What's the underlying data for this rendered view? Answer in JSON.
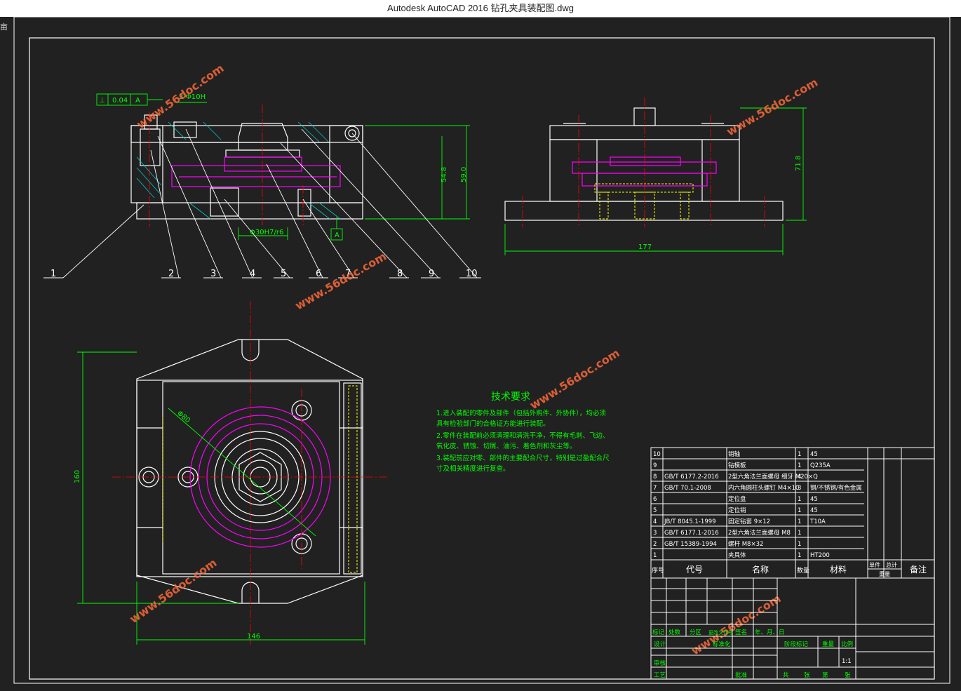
{
  "window": {
    "title": "Autodesk AutoCAD 2016    钻孔夹具装配图.dwg",
    "side_mark": "亩"
  },
  "colors": {
    "background": "#212121",
    "white_line": "#ffffff",
    "dim_green": "#00ff00",
    "magenta": "#ff00ff",
    "yellow": "#ffff00",
    "red_center": "#ff0000"
  },
  "front_view": {
    "tolerance_frame": [
      "⊥",
      "0.04",
      "A"
    ],
    "hole_note": "3-Φ10H",
    "dims": {
      "height_inner": "54.8",
      "height_outer": "59.0",
      "bore": "Φ30H7/r6"
    },
    "datum": "A",
    "balloons": [
      "1",
      "2",
      "3",
      "4",
      "5",
      "6",
      "7",
      "8",
      "9",
      "10"
    ]
  },
  "side_view": {
    "dims": {
      "height": "71.8",
      "width": "177"
    }
  },
  "top_view": {
    "dims": {
      "height": "160",
      "width": "146",
      "pcd": "Φ80"
    }
  },
  "tech_req": {
    "title": "技术要求",
    "lines": [
      "1.进入装配的零件及部件（包括外购件、外协件），均必须",
      "  具有检验部门的合格证方能进行装配。",
      "2.零件在装配前必须清理和清洗干净，不得有毛刺、飞边、",
      "  氧化皮、锈蚀、切屑、油污、着色剂和灰尘等。",
      "3.装配前应对零、部件的主要配合尺寸，特别是过盈配合尺",
      "  寸及相关精度进行复查。"
    ]
  },
  "watermark": "www.56doc.com",
  "bom": {
    "rows": [
      {
        "no": "10",
        "code": "",
        "name": "销轴",
        "qty": "1",
        "material": "45"
      },
      {
        "no": "9",
        "code": "",
        "name": "钻模板",
        "qty": "1",
        "material": "Q235A"
      },
      {
        "no": "8",
        "code": "GB/T 6177.2-2016",
        "name": "2型六角法兰面螺母 细牙 M20×Q",
        "qty": "4",
        "material": ""
      },
      {
        "no": "7",
        "code": "GB/T 70.1-2008",
        "name": "内六角圆柱头螺钉 M4×10",
        "qty": "3",
        "material": "钢/不锈钢/有色金属"
      },
      {
        "no": "6",
        "code": "",
        "name": "定位盘",
        "qty": "1",
        "material": "45"
      },
      {
        "no": "5",
        "code": "",
        "name": "定位销",
        "qty": "1",
        "material": "45"
      },
      {
        "no": "4",
        "code": "JB/T 8045.1-1999",
        "name": "固定钻套 9×12",
        "qty": "1",
        "material": "T10A"
      },
      {
        "no": "3",
        "code": "GB/T 6177.1-2016",
        "name": "2型六角法兰面螺母 M8",
        "qty": "1",
        "material": ""
      },
      {
        "no": "2",
        "code": "GB/T 15389-1994",
        "name": "螺杆 M8×32",
        "qty": "1",
        "material": ""
      },
      {
        "no": "1",
        "code": "",
        "name": "夹具体",
        "qty": "1",
        "material": "HT200"
      }
    ],
    "header": {
      "no": "序号",
      "code": "代号",
      "name": "名称",
      "qty": "数量",
      "material": "材料",
      "single": "单件",
      "total": "总计",
      "weight": "重量",
      "remark": "备注"
    },
    "title_block": {
      "mark": "标记",
      "count": "处数",
      "zone": "分区",
      "change_no": "更改文件号",
      "sign": "签名",
      "date": "年、月、日",
      "design": "设计",
      "std": "标准化",
      "stage": "阶段标记",
      "weight": "重量",
      "scale": "比例",
      "scale_val": "1:1",
      "review": "审核",
      "craft": "工艺",
      "approve": "批准",
      "total_sheets": "共",
      "sheets_unit": "张",
      "sheet_no": "第",
      "sheet_unit": "张"
    }
  }
}
